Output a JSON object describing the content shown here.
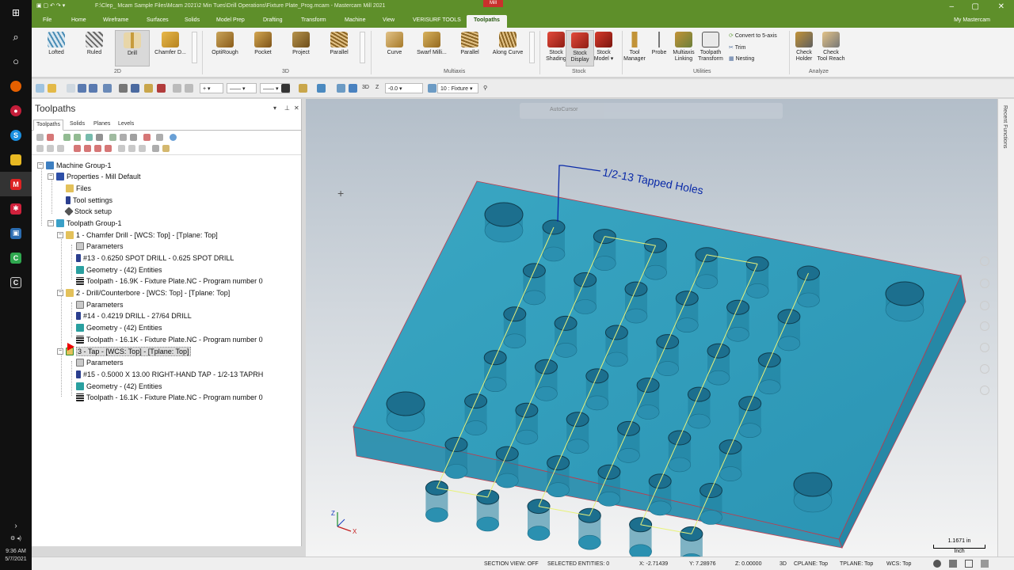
{
  "window": {
    "title": "F:\\Clep_ Mcam Sample Files\\Mcam 2021\\2 Min Tues\\Drill Operations\\Fixture Plate_Prog.mcam - Mastercam Mill 2021",
    "badge": "Mill"
  },
  "taskbar": {
    "time": "9:36 AM",
    "date": "5/7/2021"
  },
  "menu": {
    "items": [
      "File",
      "Home",
      "Wireframe",
      "Surfaces",
      "Solids",
      "Model Prep",
      "Drafting",
      "Transform",
      "Machine",
      "View",
      "VERISURF TOOLS",
      "Toolpaths"
    ],
    "active": "Toolpaths",
    "account": "My Mastercam"
  },
  "ribbon": {
    "btn2d": [
      "Lofted",
      "Ruled",
      "Drill",
      "Chamfer D..."
    ],
    "btn3d": [
      "OptiRough",
      "Pocket",
      "Project",
      "Parallel"
    ],
    "btnMulti": [
      "Curve",
      "Swarf Milli...",
      "Parallel",
      "Along Curve"
    ],
    "btnStock": [
      "Stock\nShading",
      "Stock\nDisplay",
      "Stock\nModel ▾"
    ],
    "btnUtil": [
      "Tool\nManager",
      "Probe",
      "Multiaxis\nLinking",
      "Toolpath\nTransform"
    ],
    "utilSmall": [
      "Convert to 5-axis",
      "Trim",
      "Nesting"
    ],
    "btnAnalyze": [
      "Check\nHolder",
      "Check\nTool Reach"
    ],
    "sections": [
      "2D",
      "3D",
      "Multiaxis",
      "Stock",
      "Utilities",
      "Analyze"
    ]
  },
  "qat": {
    "mode": "3D",
    "z_label": "Z",
    "z_value": "-0.0",
    "level": "10 : Fixture"
  },
  "panel": {
    "title": "Toolpaths",
    "tabs": [
      "Toolpaths",
      "Solids",
      "Planes",
      "Levels"
    ],
    "tree": [
      {
        "label": "Machine Group-1"
      },
      {
        "label": "Properties - Mill Default"
      },
      {
        "label": "Files"
      },
      {
        "label": "Tool settings"
      },
      {
        "label": "Stock setup"
      },
      {
        "label": "Toolpath Group-1"
      },
      {
        "label": "1 - Chamfer Drill - [WCS: Top] - [Tplane: Top]"
      },
      {
        "label": "Parameters"
      },
      {
        "label": "#13 - 0.6250 SPOT DRILL - 0.625 SPOT DRILL"
      },
      {
        "label": "Geometry - (42) Entities"
      },
      {
        "label": "Toolpath - 16.9K - Fixture Plate.NC - Program number 0"
      },
      {
        "label": "2 - Drill/Counterbore - [WCS: Top] - [Tplane: Top]"
      },
      {
        "label": "Parameters"
      },
      {
        "label": "#14 - 0.4219 DRILL - 27/64 DRILL"
      },
      {
        "label": "Geometry - (42) Entities"
      },
      {
        "label": "Toolpath - 16.1K - Fixture Plate.NC - Program number 0"
      },
      {
        "label": "3 - Tap - [WCS: Top] - [Tplane: Top]"
      },
      {
        "label": "Parameters"
      },
      {
        "label": "#15 - 0.5000 X 13.00 RIGHT-HAND TAP - 1/2-13 TAPRH"
      },
      {
        "label": "Geometry - (42) Entities"
      },
      {
        "label": "Toolpath - 16.1K - Fixture Plate.NC - Program number 0"
      }
    ]
  },
  "viewport": {
    "autocursor": "AutoCursor",
    "annotation": "1/2-13 Tapped Holes",
    "axis_x": "X",
    "axis_z": "Z",
    "scale_value": "1.1671 in",
    "scale_unit": "Inch",
    "recent": "Recent Functions",
    "part_color": "#2aa0c0"
  },
  "status": {
    "section_view": "SECTION VIEW: OFF",
    "selected": "SELECTED ENTITIES: 0",
    "x": "X:  -2.71439",
    "y": "Y:  7.28976",
    "z": "Z:  0.00000",
    "mode": "3D",
    "cplane": "CPLANE: Top",
    "tplane": "TPLANE: Top",
    "wcs": "WCS: Top"
  }
}
